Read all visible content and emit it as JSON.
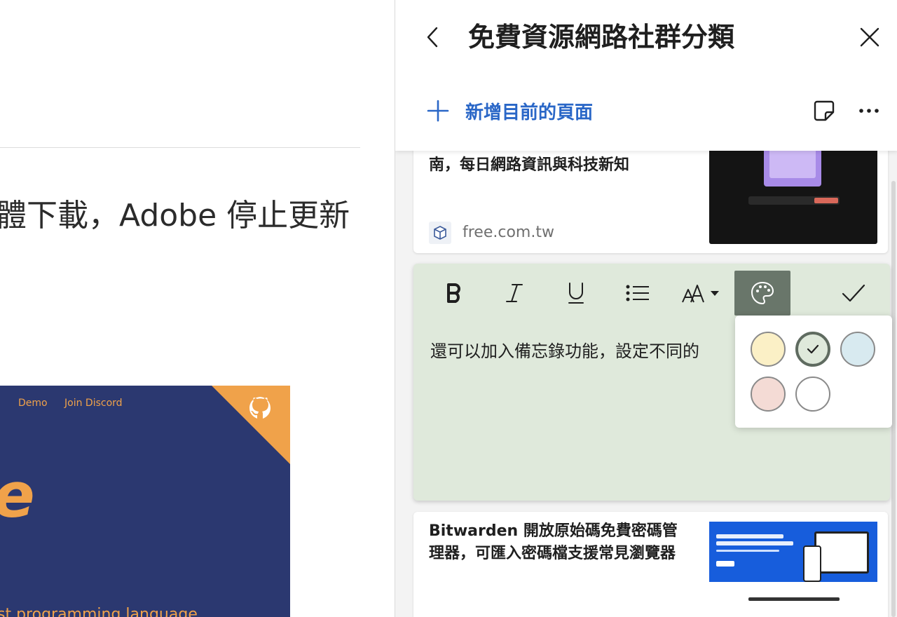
{
  "left_page": {
    "headline": "體下載，Adobe 停止更新",
    "banner": {
      "nav": [
        "Demo",
        "Join Discord"
      ],
      "logo_letter": "e",
      "tagline": "st programming language"
    }
  },
  "panel": {
    "title": "免費資源網路社群分類",
    "add_page_label": "新增目前的頁面",
    "cards": [
      {
        "title": "南，每日網路資訊與科技新知",
        "domain": "free.com.tw"
      },
      {
        "title": "Bitwarden 開放原始碼免費密碼管理器，可匯入密碼檔支援常見瀏覽器"
      }
    ],
    "note": {
      "text": "還可以加入備忘錄功能，設定不同的",
      "toolbar": [
        "bold-icon",
        "italic-icon",
        "underline-icon",
        "list-icon",
        "font-size-icon",
        "palette-icon",
        "check-icon"
      ],
      "background_color": "#dfe9db"
    },
    "color_picker": {
      "swatches": [
        {
          "name": "yellow",
          "color": "#fbf0c6",
          "selected": false
        },
        {
          "name": "green",
          "color": "#dfe9db",
          "selected": true
        },
        {
          "name": "blue",
          "color": "#d8eaf0",
          "selected": false
        },
        {
          "name": "pink",
          "color": "#f4dbd5",
          "selected": false
        },
        {
          "name": "white",
          "color": "#ffffff",
          "selected": false
        }
      ]
    }
  },
  "colors": {
    "accent": "#2a67c7",
    "banner_bg": "#2b3870",
    "banner_accent": "#f0a24a",
    "active_tool": "#69766a"
  }
}
